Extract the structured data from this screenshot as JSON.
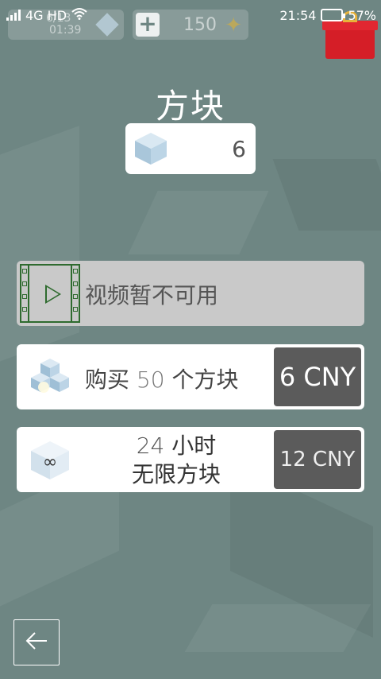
{
  "status_bar": {
    "network": "4G HD",
    "time": "21:54",
    "battery_percent": "57%",
    "battery_level": 0.57
  },
  "hud": {
    "level": "6/13",
    "level_time": "01:39",
    "coins": "150"
  },
  "title": "方块",
  "cube_count": "6",
  "options": {
    "video": {
      "label": "视频暂不可用"
    },
    "buy": {
      "label_prefix": "购买",
      "amount": "50",
      "label_suffix": "个方块",
      "price": "6 CNY"
    },
    "unlimited": {
      "hours": "24",
      "hours_unit": "小时",
      "line2": "无限方块",
      "price": "12 CNY"
    }
  },
  "colors": {
    "background": "#6e8683",
    "price_button": "#5b5b5b",
    "film_icon": "#2f6b2f",
    "gift": "#d51e27"
  },
  "icons": [
    "signal-icon",
    "wifi-icon",
    "battery-icon",
    "cube-icon",
    "plus-icon",
    "star-icon",
    "gift-icon",
    "film-play-icon",
    "cubes-stack-icon",
    "infinity-cube-icon",
    "back-arrow-icon"
  ]
}
